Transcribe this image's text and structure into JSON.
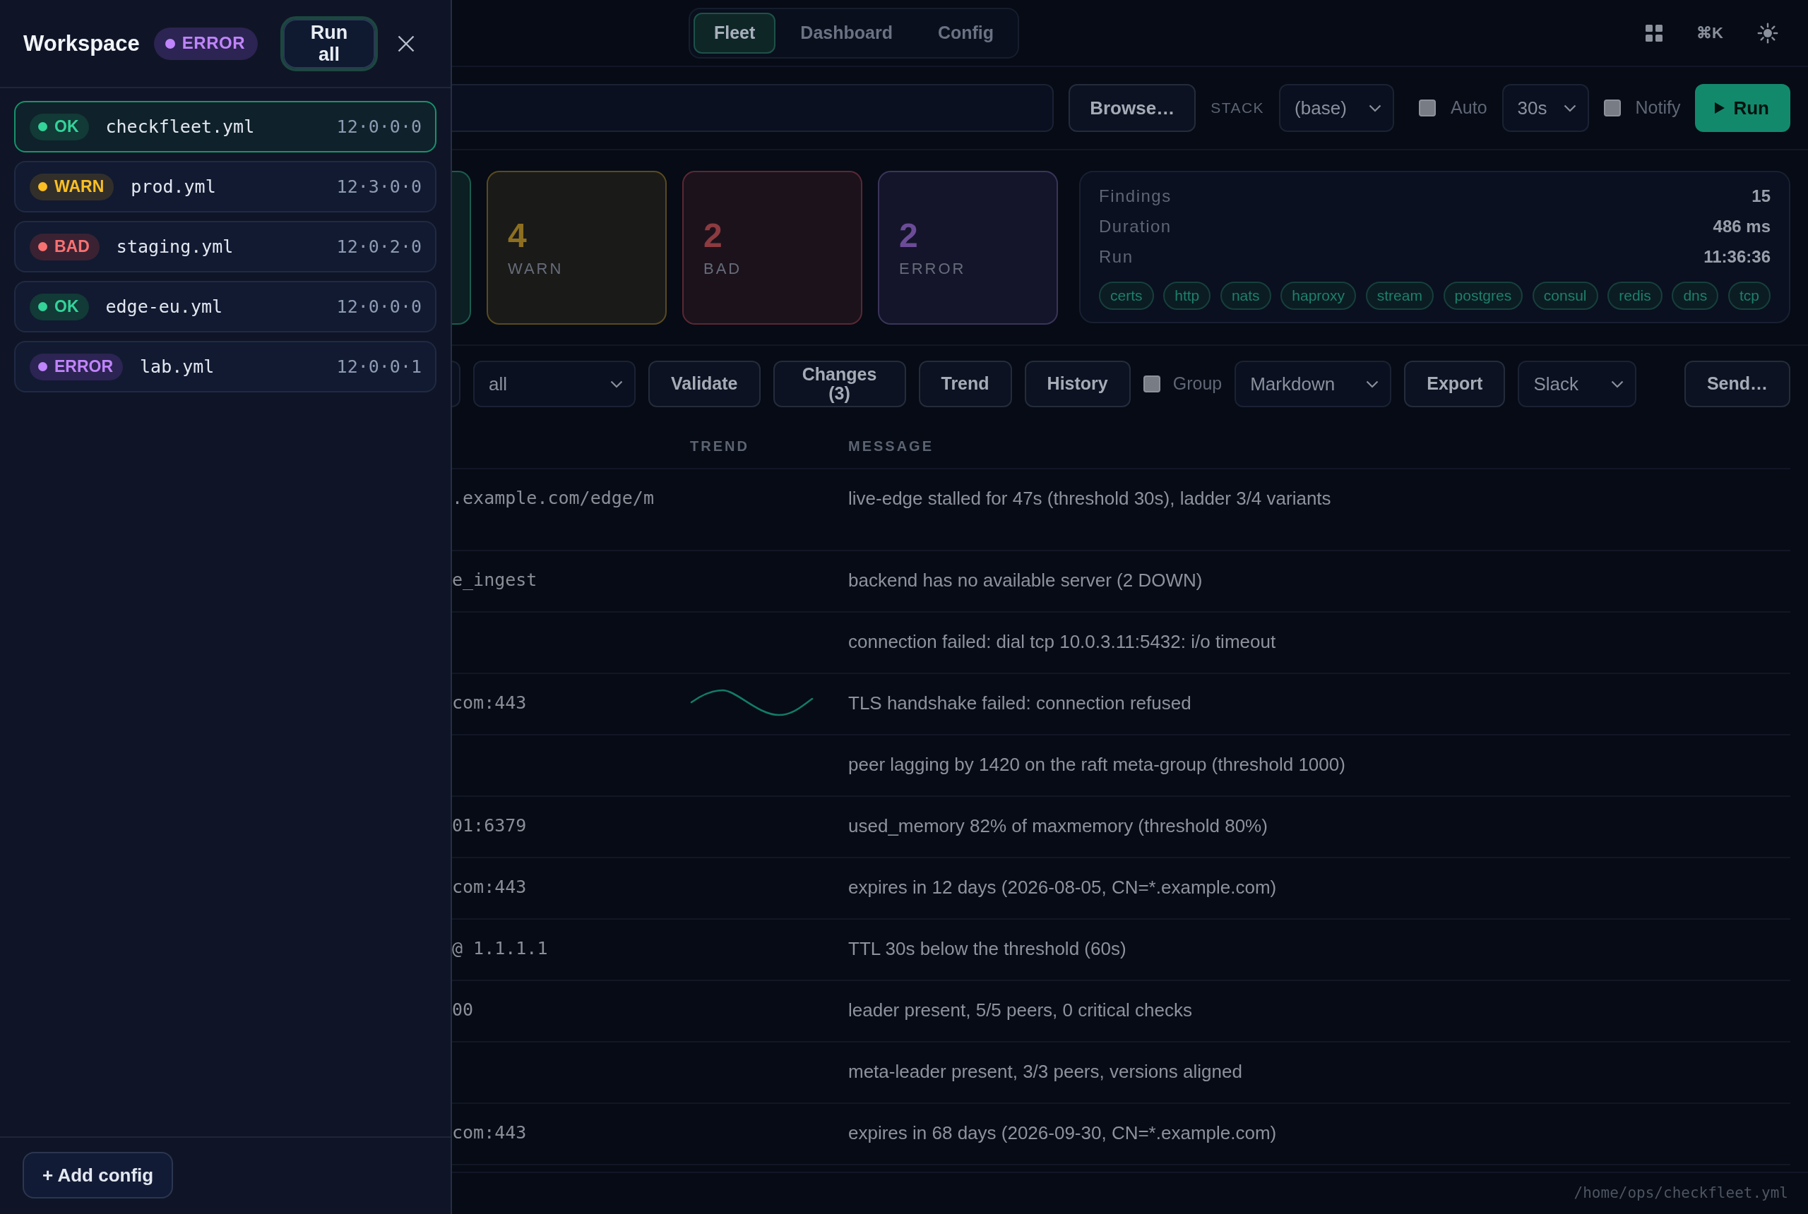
{
  "drawer": {
    "title": "Workspace",
    "status": {
      "kind": "error",
      "label": "ERROR"
    },
    "run_all": "Run all",
    "configs": [
      {
        "kind": "ok",
        "status": "OK",
        "file": "checkfleet.yml",
        "version": "12·0·0·0",
        "selected": true
      },
      {
        "kind": "warn",
        "status": "WARN",
        "file": "prod.yml",
        "version": "12·3·0·0",
        "selected": false
      },
      {
        "kind": "bad",
        "status": "BAD",
        "file": "staging.yml",
        "version": "12·0·2·0",
        "selected": false
      },
      {
        "kind": "ok",
        "status": "OK",
        "file": "edge-eu.yml",
        "version": "12·0·0·0",
        "selected": false
      },
      {
        "kind": "error",
        "status": "ERROR",
        "file": "lab.yml",
        "version": "12·0·0·1",
        "selected": false
      }
    ],
    "add_config": "+ Add config"
  },
  "nav": {
    "tabs": [
      {
        "label": "Fleet",
        "selected": true
      },
      {
        "label": "Dashboard",
        "selected": false
      },
      {
        "label": "Config",
        "selected": false
      }
    ],
    "shortcut": "⌘K"
  },
  "source_bar": {
    "browse": "Browse…",
    "stack_label": "STACK",
    "stack": "(base)",
    "auto": {
      "label": "Auto",
      "checked": false
    },
    "interval": "30s",
    "notify": {
      "label": "Notify",
      "checked": false
    },
    "run": "Run"
  },
  "cards": [
    {
      "kind": "ok"
    },
    {
      "kind": "warn",
      "value": "4",
      "label": "WARN"
    },
    {
      "kind": "bad",
      "value": "2",
      "label": "BAD"
    },
    {
      "kind": "error",
      "value": "2",
      "label": "ERROR"
    }
  ],
  "summary": {
    "rows": [
      {
        "label": "Findings",
        "value": "15"
      },
      {
        "label": "Duration",
        "value": "486 ms"
      },
      {
        "label": "Run",
        "value": "11:36:36"
      }
    ],
    "tags": [
      "certs",
      "http",
      "nats",
      "haproxy",
      "stream",
      "postgres",
      "consul",
      "redis",
      "dns",
      "tcp"
    ]
  },
  "toolbar": {
    "filter": "all",
    "buttons": [
      "Validate",
      "Changes (3)",
      "Trend",
      "History"
    ],
    "group": {
      "label": "Group",
      "checked": false
    },
    "format": "Markdown",
    "export": "Export",
    "channel": "Slack",
    "send": "Send…"
  },
  "table": {
    "columns": [
      "TREND",
      "MESSAGE"
    ],
    "rows": [
      {
        "column_1": ".example.com/edge/m",
        "trend": false,
        "message": "live-edge stalled for 47s (threshold 30s), ladder 3/4 variants"
      },
      {
        "column_1": "e_ingest",
        "trend": false,
        "message": "backend has no available server (2 DOWN)"
      },
      {
        "trend": false,
        "message": "connection failed: dial tcp 10.0.3.11:5432: i/o timeout"
      },
      {
        "column_1": "com:443",
        "trend": true,
        "message": "TLS handshake failed: connection refused"
      },
      {
        "trend": false,
        "message": "peer lagging by 1420 on the raft meta-group (threshold 1000)"
      },
      {
        "column_1": "01:6379",
        "trend": false,
        "message": "used_memory 82% of maxmemory (threshold 80%)"
      },
      {
        "column_1": "com:443",
        "trend": false,
        "message": "expires in 12 days (2026-08-05, CN=*.example.com)"
      },
      {
        "column_1": "@ 1.1.1.1",
        "trend": false,
        "message": "TTL 30s below the threshold (60s)"
      },
      {
        "column_1": "00",
        "trend": false,
        "message": "leader present, 5/5 peers, 0 critical checks"
      },
      {
        "trend": false,
        "message": "meta-leader present, 3/3 peers, versions aligned"
      },
      {
        "column_1": "com:443",
        "trend": false,
        "message": "expires in 68 days (2026-09-30, CN=*.example.com)"
      }
    ]
  },
  "status_bar": {
    "path": "/home/ops/checkfleet.yml"
  }
}
